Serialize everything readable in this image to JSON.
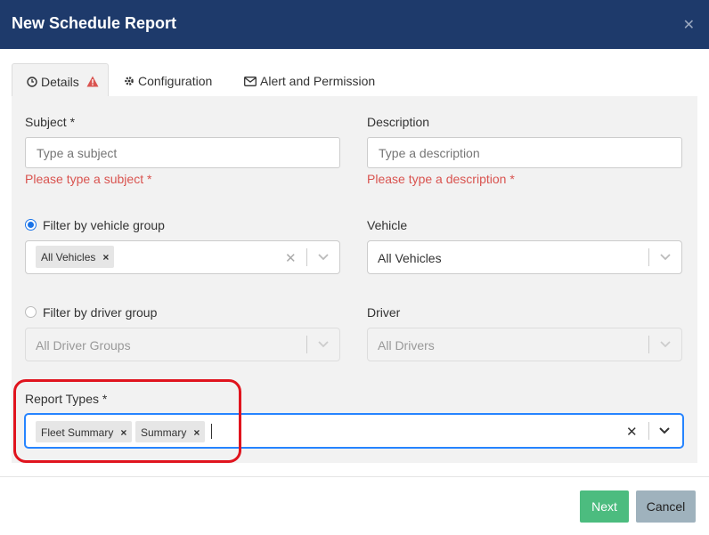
{
  "dialog": {
    "title": "New Schedule Report",
    "close_symbol": "✕"
  },
  "tabs": [
    {
      "label": "Details",
      "icon": "clock-icon",
      "warning_icon": "warning-icon",
      "active": true
    },
    {
      "label": "Configuration",
      "icon": "gear-icon",
      "active": false
    },
    {
      "label": "Alert and Permission",
      "icon": "envelope-icon",
      "active": false
    }
  ],
  "form": {
    "subject": {
      "label": "Subject *",
      "placeholder": "Type a subject",
      "value": "",
      "error": "Please type a subject *"
    },
    "description": {
      "label": "Description",
      "placeholder": "Type a description",
      "value": "",
      "error": "Please type a description *"
    },
    "vehicle_group": {
      "label": "Filter by vehicle group",
      "selected": true,
      "chips": [
        "All Vehicles"
      ]
    },
    "vehicle": {
      "label": "Vehicle",
      "value": "All Vehicles"
    },
    "driver_group": {
      "label": "Filter by driver group",
      "selected": false,
      "value": "All Driver Groups"
    },
    "driver": {
      "label": "Driver",
      "value": "All Drivers"
    },
    "report_types": {
      "label": "Report Types *",
      "chips": [
        "Fleet Summary",
        "Summary"
      ]
    }
  },
  "footer": {
    "next_label": "Next",
    "cancel_label": "Cancel"
  },
  "colors": {
    "header": "#1e3a6b",
    "error": "#d9534f",
    "next": "#4cbc7f",
    "cancel": "#9fb2bd",
    "focus": "#2684ff",
    "highlight": "#e0141e"
  }
}
